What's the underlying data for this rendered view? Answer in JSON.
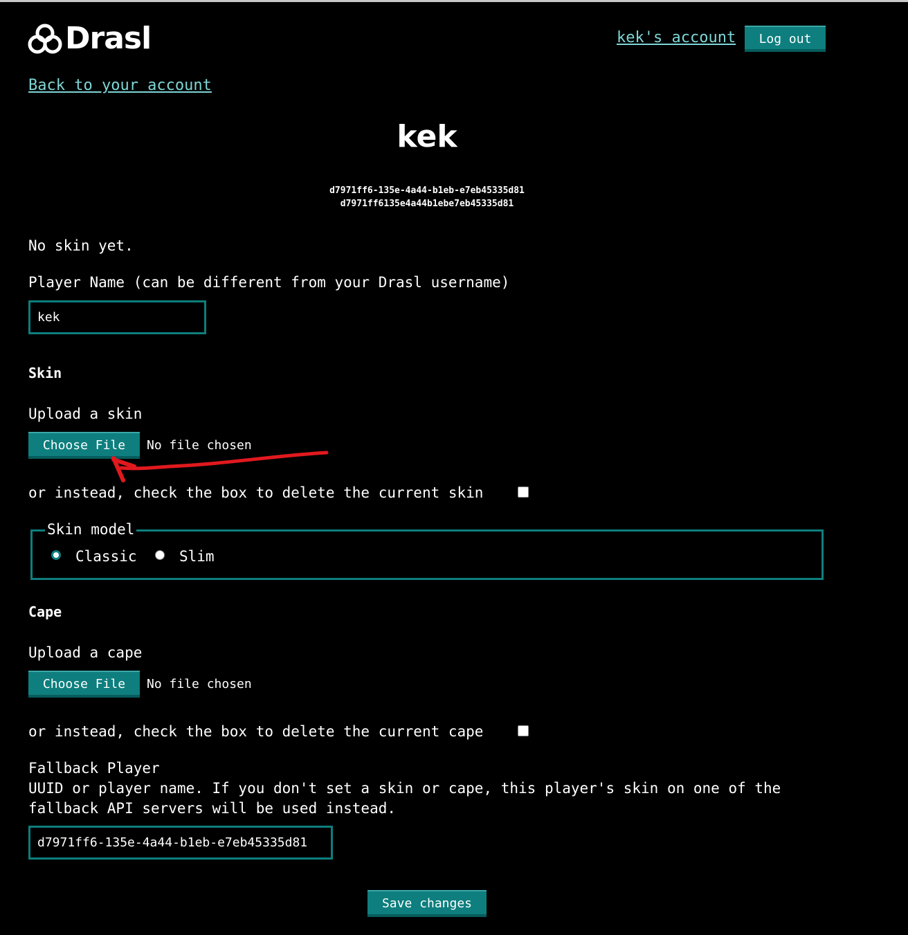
{
  "header": {
    "logo_text": "Drasl",
    "account_link": "kek's account",
    "logout_button": "Log out"
  },
  "nav": {
    "back_link": "Back to your account"
  },
  "player": {
    "name": "kek",
    "uuid_dashed": "d7971ff6-135e-4a44-b1eb-e7eb45335d81",
    "uuid_plain": "d7971ff6135e4a44b1ebe7eb45335d81"
  },
  "form": {
    "no_skin_text": "No skin yet.",
    "player_name_label": "Player Name (can be different from your Drasl username)",
    "player_name_value": "kek",
    "skin_heading": "Skin",
    "upload_skin_label": "Upload a skin",
    "choose_file_label": "Choose File",
    "no_file_chosen": "No file chosen",
    "delete_skin_label": "or instead, check the box to delete the current skin",
    "skin_model_legend": "Skin model",
    "model_options": [
      "Classic",
      "Slim"
    ],
    "selected_model": "Classic",
    "cape_heading": "Cape",
    "upload_cape_label": "Upload a cape",
    "delete_cape_label": "or instead, check the box to delete the current cape",
    "fallback_label": "Fallback Player",
    "fallback_help_line1": "UUID or player name. If you don't set a skin or cape, this player's skin on one of the",
    "fallback_help_line2": "fallback API servers will be used instead.",
    "fallback_value": "d7971ff6-135e-4a44-b1eb-e7eb45335d81",
    "save_button": "Save changes"
  },
  "colors": {
    "accent": "#0e7e7e",
    "link": "#7fd6d6",
    "annotation": "#e0191e",
    "background": "#000000"
  }
}
